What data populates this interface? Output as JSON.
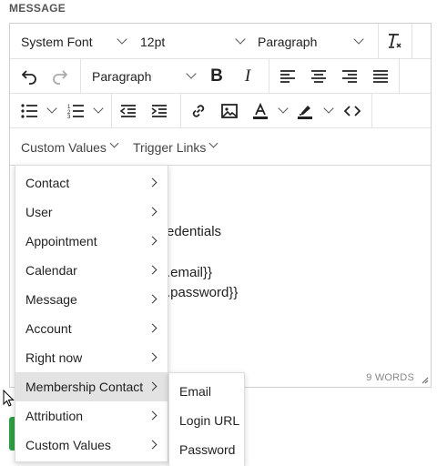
{
  "label": "MESSAGE",
  "toolbar": {
    "font_family": "System Font",
    "font_size": "12pt",
    "block_format_top": "Paragraph",
    "block_format": "Paragraph"
  },
  "row4": {
    "custom_values": "Custom Values",
    "trigger_links": "Trigger Links"
  },
  "content": {
    "line1": "edentials",
    "line2": ".email}}",
    "line3": ".password}}"
  },
  "status": {
    "words": "9 WORDS"
  },
  "menu": {
    "items": [
      {
        "label": "Contact"
      },
      {
        "label": "User"
      },
      {
        "label": "Appointment"
      },
      {
        "label": "Calendar"
      },
      {
        "label": "Message"
      },
      {
        "label": "Account"
      },
      {
        "label": "Right now"
      },
      {
        "label": "Membership Contact"
      },
      {
        "label": "Attribution"
      },
      {
        "label": "Custom Values"
      }
    ],
    "active_index": 7
  },
  "submenu": {
    "items": [
      {
        "label": "Email"
      },
      {
        "label": "Login URL"
      },
      {
        "label": "Password"
      }
    ]
  }
}
